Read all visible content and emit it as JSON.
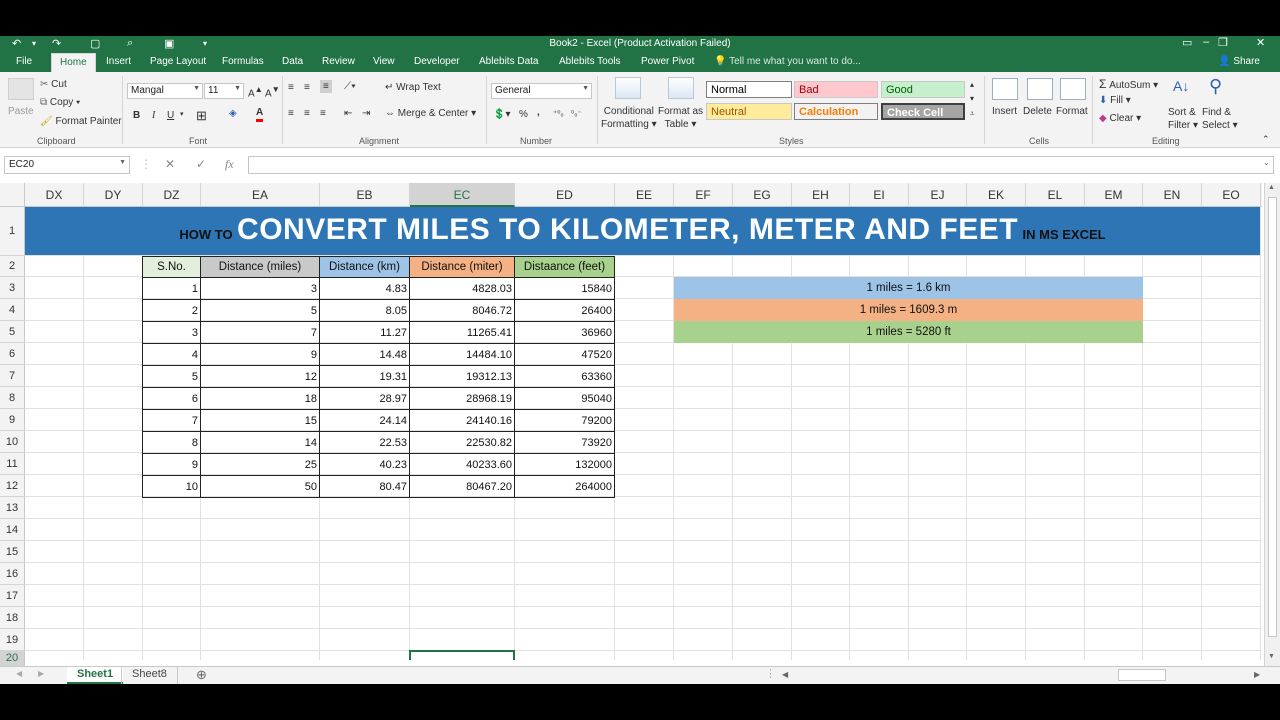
{
  "window": {
    "title": "Book2 - Excel (Product Activation Failed)"
  },
  "tabs": [
    {
      "label": "File",
      "active": false
    },
    {
      "label": "Home",
      "active": true
    },
    {
      "label": "Insert",
      "active": false
    },
    {
      "label": "Page Layout",
      "active": false
    },
    {
      "label": "Formulas",
      "active": false
    },
    {
      "label": "Data",
      "active": false
    },
    {
      "label": "Review",
      "active": false
    },
    {
      "label": "View",
      "active": false
    },
    {
      "label": "Developer",
      "active": false
    },
    {
      "label": "Ablebits Data",
      "active": false
    },
    {
      "label": "Ablebits Tools",
      "active": false
    },
    {
      "label": "Power Pivot",
      "active": false
    }
  ],
  "tell_me": "Tell me what you want to do...",
  "share": "Share",
  "ribbon": {
    "clipboard": {
      "paste": "Paste",
      "cut": "Cut",
      "copy": "Copy",
      "format_painter": "Format Painter",
      "label": "Clipboard"
    },
    "font": {
      "name": "Mangal",
      "size": "11",
      "bold": "B",
      "italic": "I",
      "underline": "U",
      "label": "Font"
    },
    "alignment": {
      "wrap_text": "Wrap Text",
      "merge_center": "Merge & Center",
      "label": "Alignment"
    },
    "number": {
      "format": "General",
      "percent": "%",
      "comma": ",",
      "label": "Number"
    },
    "styles": {
      "conditional": [
        "Conditional",
        "Formatting"
      ],
      "format_as_table": [
        "Format as",
        "Table"
      ],
      "cells": [
        {
          "label": "Normal",
          "bg": "#ffffff",
          "fg": "#000000"
        },
        {
          "label": "Bad",
          "bg": "#ffc7ce",
          "fg": "#9c0006"
        },
        {
          "label": "Good",
          "bg": "#c6efce",
          "fg": "#006100"
        },
        {
          "label": "Neutral",
          "bg": "#ffeb9c",
          "fg": "#9c5700"
        },
        {
          "label": "Calculation",
          "bg": "#f2f2f2",
          "fg": "#fa7d00"
        },
        {
          "label": "Check Cell",
          "bg": "#a5a5a5",
          "fg": "#ffffff"
        }
      ],
      "label": "Styles"
    },
    "cells": {
      "insert": "Insert",
      "delete": "Delete",
      "format": "Format",
      "label": "Cells"
    },
    "editing": {
      "autosum": "AutoSum",
      "fill": "Fill",
      "clear": "Clear",
      "sort_filter": [
        "Sort &",
        "Filter"
      ],
      "find_select": [
        "Find &",
        "Select"
      ],
      "label": "Editing"
    }
  },
  "formula_bar": {
    "name_box": "EC20",
    "formula": ""
  },
  "columns": [
    "DX",
    "DY",
    "DZ",
    "EA",
    "EB",
    "EC",
    "ED",
    "EE",
    "EF",
    "EG",
    "EH",
    "EI",
    "EJ",
    "EK",
    "EL",
    "EM",
    "EN",
    "EO"
  ],
  "selected_column": "EC",
  "rows": [
    "1",
    "2",
    "3",
    "4",
    "5",
    "6",
    "7",
    "8",
    "9",
    "10",
    "11",
    "12",
    "13",
    "14",
    "15",
    "16",
    "17",
    "18",
    "19",
    "20"
  ],
  "selected_row": "20",
  "banner": {
    "prefix": "HOW TO",
    "main": "CONVERT MILES TO KILOMETER, METER AND FEET",
    "suffix": "IN MS EXCEL"
  },
  "table": {
    "headers": [
      "S.No.",
      "Distance (miles)",
      "Distance (km)",
      "Distance (miter)",
      "Distaance (feet)"
    ],
    "rows": [
      [
        "1",
        "3",
        "4.83",
        "4828.03",
        "15840"
      ],
      [
        "2",
        "5",
        "8.05",
        "8046.72",
        "26400"
      ],
      [
        "3",
        "7",
        "11.27",
        "11265.41",
        "36960"
      ],
      [
        "4",
        "9",
        "14.48",
        "14484.10",
        "47520"
      ],
      [
        "5",
        "12",
        "19.31",
        "19312.13",
        "63360"
      ],
      [
        "6",
        "18",
        "28.97",
        "28968.19",
        "95040"
      ],
      [
        "7",
        "15",
        "24.14",
        "24140.16",
        "79200"
      ],
      [
        "8",
        "14",
        "22.53",
        "22530.82",
        "73920"
      ],
      [
        "9",
        "25",
        "40.23",
        "40233.60",
        "132000"
      ],
      [
        "10",
        "50",
        "80.47",
        "80467.20",
        "264000"
      ]
    ]
  },
  "conversions": [
    {
      "text": "1 miles = 1.6 km",
      "color": "#9dc3e6"
    },
    {
      "text": "1 miles = 1609.3 m",
      "color": "#f4b183"
    },
    {
      "text": "1 miles = 5280 ft",
      "color": "#a9d18e"
    }
  ],
  "sheets": [
    {
      "label": "Sheet1",
      "active": true
    },
    {
      "label": "Sheet8",
      "active": false
    }
  ]
}
